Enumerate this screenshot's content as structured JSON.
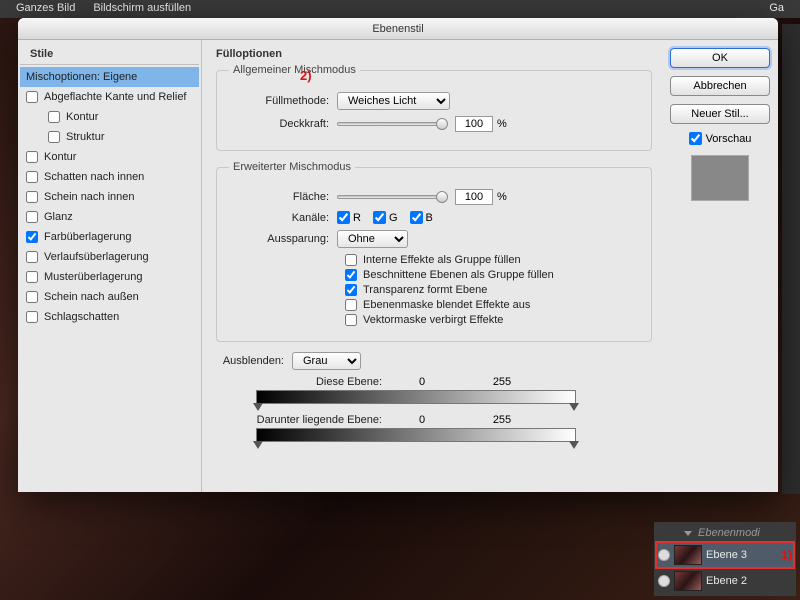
{
  "topbar": {
    "ganzes": "Ganzes Bild",
    "ausfuellen": "Bildschirm ausfüllen",
    "right": "Ga"
  },
  "dialog": {
    "title": "Ebenenstil",
    "stylesHead": "Stile",
    "styles": [
      {
        "label": "Mischoptionen: Eigene",
        "checked": false,
        "sel": true,
        "nochk": true
      },
      {
        "label": "Abgeflachte Kante und Relief",
        "checked": false
      },
      {
        "label": "Kontur",
        "checked": false,
        "indent": true
      },
      {
        "label": "Struktur",
        "checked": false,
        "indent": true
      },
      {
        "label": "Kontur",
        "checked": false
      },
      {
        "label": "Schatten nach innen",
        "checked": false
      },
      {
        "label": "Schein nach innen",
        "checked": false
      },
      {
        "label": "Glanz",
        "checked": false
      },
      {
        "label": "Farbüberlagerung",
        "checked": true
      },
      {
        "label": "Verlaufsüberlagerung",
        "checked": false
      },
      {
        "label": "Musterüberlagerung",
        "checked": false
      },
      {
        "label": "Schein nach außen",
        "checked": false
      },
      {
        "label": "Schlagschatten",
        "checked": false
      }
    ],
    "fill": {
      "heading": "Fülloptionen",
      "legend1": "Allgemeiner Mischmodus",
      "fuellmethodeLabel": "Füllmethode:",
      "fuellmethodeValue": "Weiches Licht",
      "deckkraftLabel": "Deckkraft:",
      "deckkraftValue": "100",
      "pct": "%",
      "annot2": "2)"
    },
    "adv": {
      "legend": "Erweiterter Mischmodus",
      "flaecheLabel": "Fläche:",
      "flaecheValue": "100",
      "kanaeleLabel": "Kanäle:",
      "R": "R",
      "G": "G",
      "B": "B",
      "aussparungLabel": "Aussparung:",
      "aussparungValue": "Ohne",
      "o1": "Interne Effekte als Gruppe füllen",
      "o2": "Beschnittene Ebenen als Gruppe füllen",
      "o3": "Transparenz formt Ebene",
      "o4": "Ebenenmaske blendet Effekte aus",
      "o5": "Vektormaske verbirgt Effekte"
    },
    "blend": {
      "ausblendenLabel": "Ausblenden:",
      "ausblendenValue": "Grau",
      "dieseEbene": "Diese Ebene:",
      "darunter": "Darunter liegende Ebene:",
      "v0": "0",
      "v255": "255"
    },
    "buttons": {
      "ok": "OK",
      "cancel": "Abbrechen",
      "newStyle": "Neuer Stil...",
      "preview": "Vorschau"
    }
  },
  "layers": {
    "modeLabel": "Ebenenmodi",
    "rows": [
      {
        "name": "Ebene 3",
        "hl": true,
        "annot": "1)"
      },
      {
        "name": "Ebene 2",
        "hl": false
      }
    ]
  }
}
